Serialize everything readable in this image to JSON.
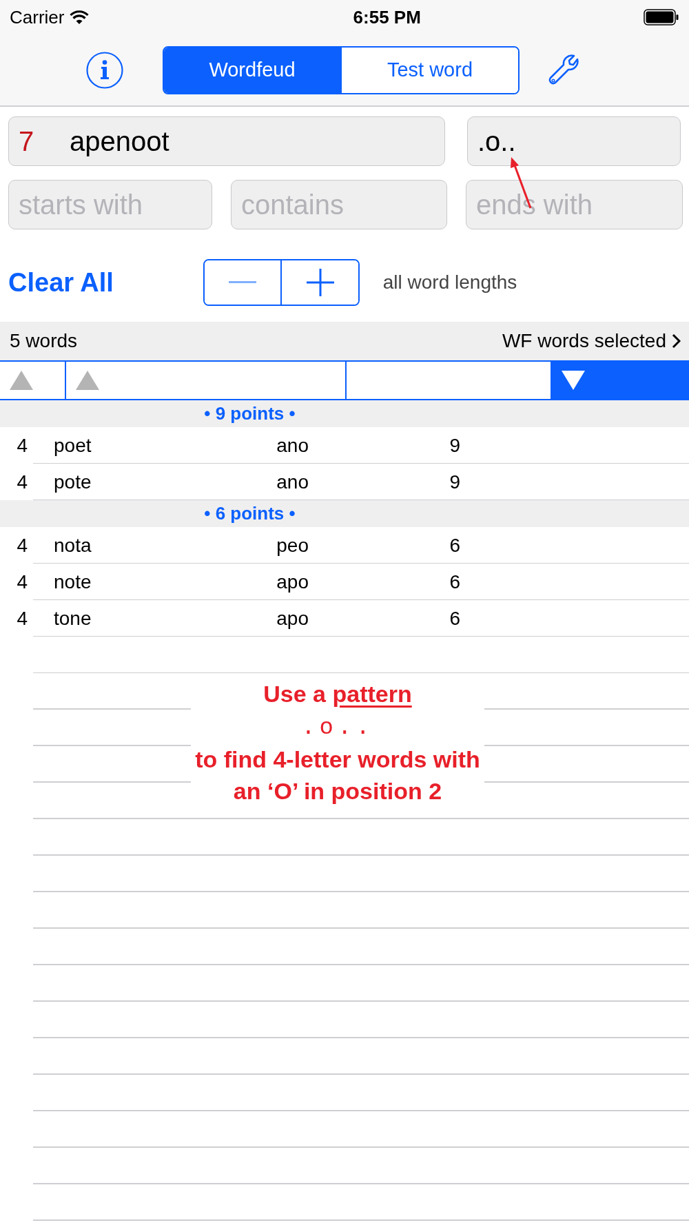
{
  "status_bar": {
    "carrier": "Carrier",
    "time": "6:55 PM"
  },
  "toolbar": {
    "segments": [
      {
        "label": "Wordfeud",
        "selected": true
      },
      {
        "label": "Test word",
        "selected": false
      }
    ]
  },
  "letters_field": {
    "count": "7",
    "value": "apenoot"
  },
  "pattern_field": {
    "value": ".o.."
  },
  "filters": [
    {
      "placeholder": "starts with"
    },
    {
      "placeholder": "contains"
    },
    {
      "placeholder": "ends with"
    }
  ],
  "clear_all": "Clear All",
  "stepper": {
    "decrease_disabled": true,
    "increase_disabled": false
  },
  "length_label": "all word lengths",
  "summary": {
    "count": "5 words",
    "selection": "WF words selected"
  },
  "sort_columns": [
    {
      "sorted": true,
      "descending": false,
      "selected": false
    },
    {
      "sorted": true,
      "descending": false,
      "selected": false
    },
    {
      "sorted": false,
      "selected": false
    },
    {
      "sorted": true,
      "descending": true,
      "selected": true
    }
  ],
  "sections": [
    {
      "title": "• 9 points •",
      "rows": [
        {
          "length": "4",
          "word": "poet",
          "letters": "ano",
          "points": "9"
        },
        {
          "length": "4",
          "word": "pote",
          "letters": "ano",
          "points": "9"
        }
      ]
    },
    {
      "title": "• 6 points •",
      "rows": [
        {
          "length": "4",
          "word": "nota",
          "letters": "peo",
          "points": "6"
        },
        {
          "length": "4",
          "word": "note",
          "letters": "apo",
          "points": "6"
        },
        {
          "length": "4",
          "word": "tone",
          "letters": "apo",
          "points": "6"
        }
      ]
    }
  ],
  "annotation": {
    "intro": "Use a",
    "keyword": "pattern",
    "pattern": ".o..",
    "lines": [
      "to find 4-letter words with",
      "an ‘O’ in position 2"
    ]
  }
}
